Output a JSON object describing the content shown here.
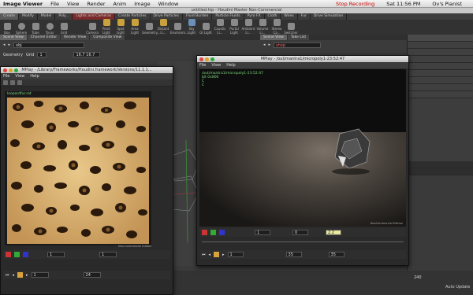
{
  "menubar": {
    "app": "Image Viewer",
    "items": [
      "File",
      "View",
      "Render",
      "Anim",
      "Image",
      "Window"
    ],
    "recording": "Stop Recording",
    "clock": "Sat 11:56 PM",
    "user": "Ov's Pianist"
  },
  "houdini": {
    "title": "untitled.hip - Houdini Master Non-Commercial"
  },
  "shelf_tabs": [
    "Create",
    "Modify",
    "Model",
    "Poly...",
    "Lights and Cameras",
    "Create Particles",
    "Drive Particles",
    "Fluid Burden",
    "Particle Fluids",
    "Pyro FX",
    "Cloth",
    "Wires",
    "Fur",
    "Drive Simulation"
  ],
  "shelf_tools": [
    "Box",
    "Sphere",
    "Tube",
    "Torus",
    "Grid",
    "Camera",
    "Point Light",
    "Spot Light",
    "Area Light",
    "Geometry...",
    "Distant Li...",
    "Environm...",
    "Sky Light",
    "GI Light",
    "Caustic Li...",
    "Portal Light",
    "Ambient Li...",
    "Volume Li...",
    "Stereo Ca...",
    "Switcher"
  ],
  "pane_tabs_left": [
    "Scene View",
    "Channel Editor",
    "Render View",
    "Composite View"
  ],
  "pane_tabs_right": [
    "Scene View",
    "Take List"
  ],
  "obj_path": "obj",
  "shop_path": "shop",
  "geo_row": {
    "label": "Geometry",
    "grid": "Grid",
    "frame": "1",
    "size": "16.7 16.7"
  },
  "win1": {
    "title": "MPlay - /Library/Frameworks/Houdini.framework/Versions/11.1.1...",
    "menu": [
      "File",
      "View",
      "Help"
    ],
    "image_name": "leopardfur.rat",
    "watermark": "Non-Commercial Edition",
    "frame_start": "1",
    "frame_end": "24",
    "current": "1"
  },
  "win2": {
    "title": "MPlay - /out/mantra1/micropoly1-23:52:47",
    "menu": [
      "File",
      "View",
      "Help"
    ],
    "info_lines": [
      "/out/mantra1/micropoly1-23:52:47",
      "bit 0x800",
      "C",
      "C"
    ],
    "watermark": "NonCommercial Edition",
    "start": "1",
    "end": "35",
    "value1": "1",
    "value2": "0",
    "gamma": "2.2",
    "frame": "35"
  },
  "bottom": {
    "frame_end": "240",
    "auto_update": "Auto Update"
  },
  "colors": {
    "accent": "#d7a33a",
    "green_text": "#7fd97f",
    "mac_red": "#e0443e",
    "mac_yellow": "#dea123",
    "mac_green": "#27a93a"
  }
}
